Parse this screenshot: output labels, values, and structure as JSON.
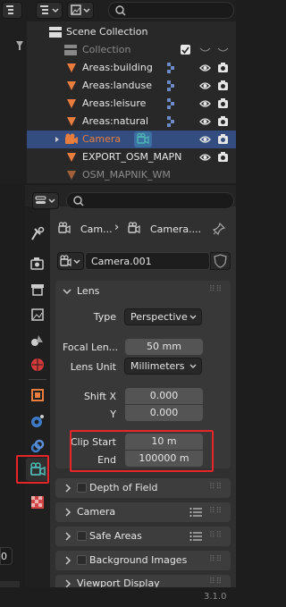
{
  "outliner": {
    "scene_collection": "Scene Collection",
    "collection": "Collection",
    "items": [
      {
        "label": "Areas:building"
      },
      {
        "label": "Areas:landuse"
      },
      {
        "label": "Areas:leisure"
      },
      {
        "label": "Areas:natural"
      },
      {
        "label": "Camera"
      },
      {
        "label": "EXPORT_OSM_MAPN"
      },
      {
        "label": "OSM_MAPNIK_WM"
      }
    ]
  },
  "properties": {
    "breadcrumb_a": "Cam...",
    "breadcrumb_b": "Camera....",
    "data_name": "Camera.001",
    "lens_panel": {
      "title": "Lens",
      "type_label": "Type",
      "type_value": "Perspective",
      "focal_label": "Focal Len...",
      "focal_value": "50 mm",
      "lens_unit_label": "Lens Unit",
      "lens_unit_value": "Millimeters",
      "shift_x_label": "Shift X",
      "shift_x_value": "0.000",
      "y_label": "Y",
      "y_value": "0.000",
      "clip_start_label": "Clip Start",
      "clip_start_value": "10 m",
      "end_label": "End",
      "end_value": "100000 m"
    },
    "panels": [
      {
        "title": "Depth of Field"
      },
      {
        "title": "Camera"
      },
      {
        "title": "Safe Areas"
      },
      {
        "title": "Background Images"
      },
      {
        "title": "Viewport Display"
      }
    ]
  },
  "left_field_value": "0",
  "version": "3.1.0",
  "colors": {
    "highlight": "#e8262a",
    "selection": "#334d80",
    "accent_orange": "#e87d3e",
    "camera_green": "#4fb8b4"
  }
}
